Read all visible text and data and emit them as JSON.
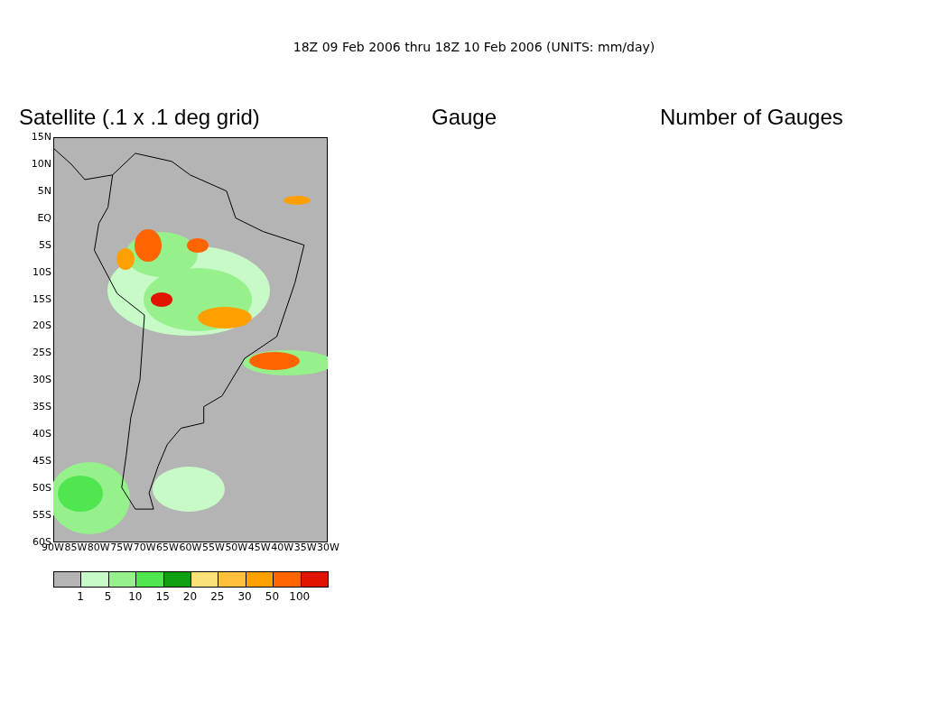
{
  "title": "18Z 09 Feb 2006 thru 18Z 10 Feb 2006 (UNITS: mm/day)",
  "panels": [
    {
      "heading": "Satellite (.1 x .1 deg grid)",
      "kind": "map"
    },
    {
      "heading": "Gauge",
      "kind": "empty"
    },
    {
      "heading": "Number of Gauges",
      "kind": "empty"
    }
  ],
  "map": {
    "lat_labels": [
      "15N",
      "10N",
      "5N",
      "EQ",
      "5S",
      "10S",
      "15S",
      "20S",
      "25S",
      "30S",
      "35S",
      "40S",
      "45S",
      "50S",
      "55S",
      "60S"
    ],
    "lon_labels": [
      "90W",
      "85W",
      "80W",
      "75W",
      "70W",
      "65W",
      "60W",
      "55W",
      "50W",
      "45W",
      "40W",
      "35W",
      "30W"
    ]
  },
  "colorbar": {
    "segments": [
      {
        "color": "#b4b4b4"
      },
      {
        "color": "#c8fac8"
      },
      {
        "color": "#96f08c"
      },
      {
        "color": "#50e650"
      },
      {
        "color": "#0fa00f"
      },
      {
        "color": "#fae178"
      },
      {
        "color": "#ffc03c"
      },
      {
        "color": "#ffa000"
      },
      {
        "color": "#ff6400"
      },
      {
        "color": "#e11400"
      }
    ],
    "labels": [
      "1",
      "5",
      "10",
      "15",
      "20",
      "25",
      "30",
      "50",
      "100"
    ]
  }
}
